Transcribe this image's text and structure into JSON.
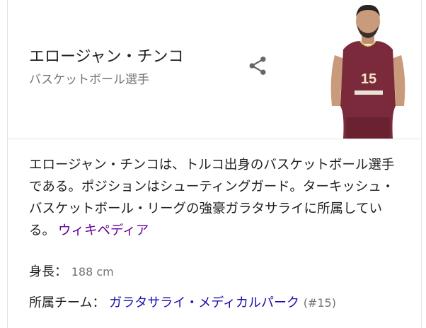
{
  "entity": {
    "name": "エロージャン・チンコ",
    "type": "バスケットボール選手"
  },
  "share": {
    "icon": "share-icon"
  },
  "photo": {
    "jersey_number": "15",
    "jersey_color": "#7a2a3a"
  },
  "description": {
    "text": "エロージャン・チンコは、トルコ出身のバスケットボール選手である。ポジションはシューティングガード。ターキッシュ・バスケットボール・リーグの強豪ガラタサライに所属している。",
    "source_link": "ウィキペディア"
  },
  "facts": {
    "height": {
      "label": "身長",
      "value": "188 cm"
    },
    "team": {
      "label": "所属チーム",
      "value": "ガラタサライ・メディカルパーク",
      "number": "(#15)"
    }
  },
  "colors": {
    "link": "#1a0dab",
    "visited_link": "#660099",
    "muted": "#70757a"
  }
}
